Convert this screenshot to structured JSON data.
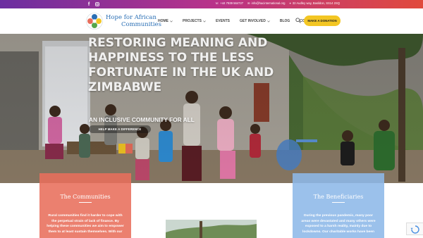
{
  "topbar": {
    "phone": "+44 7939 564727",
    "email": "info@hacinternational.org",
    "address": "32 Audley way, Basildon, SS14 2SQ"
  },
  "nav": {
    "brand_line1": "Hope for African",
    "brand_line2": "Communities",
    "items": [
      "HOME",
      "PROJECTS",
      "EVENTS",
      "GET INVOLVED",
      "BLOG",
      "CONTACT"
    ],
    "cta": "MAKE A DONATION"
  },
  "hero": {
    "title": "RESTORING MEANING AND HAPPINESS TO THE LESS FORTUNATE IN THE UK AND ZIMBABWE",
    "subtitle": "AN INCLUSIVE COMMUNITY FOR ALL",
    "button": "HELP MAKE A DIFFERENCE"
  },
  "cards": [
    {
      "title": "The Communities",
      "text": "Rural communities find it harder to cope with the perpetual strain of lack of finance. By helping these communities we aim to empower them to at least sustain themselves. With our"
    },
    {
      "title": "The Beneficiaries",
      "text": "During the previous pandemic, many poor areas were devastated and many others were exposed to a harsh reality, mainly due to lockdowns. Our charitable works have been"
    }
  ],
  "colors": {
    "topbar_start": "#6b2ea0",
    "topbar_end": "#e14a3c",
    "brand_text": "#2a6fb5",
    "donate_button": "#f3c623",
    "card_communities": "#e86e5b",
    "card_beneficiaries": "#8db8e8"
  }
}
